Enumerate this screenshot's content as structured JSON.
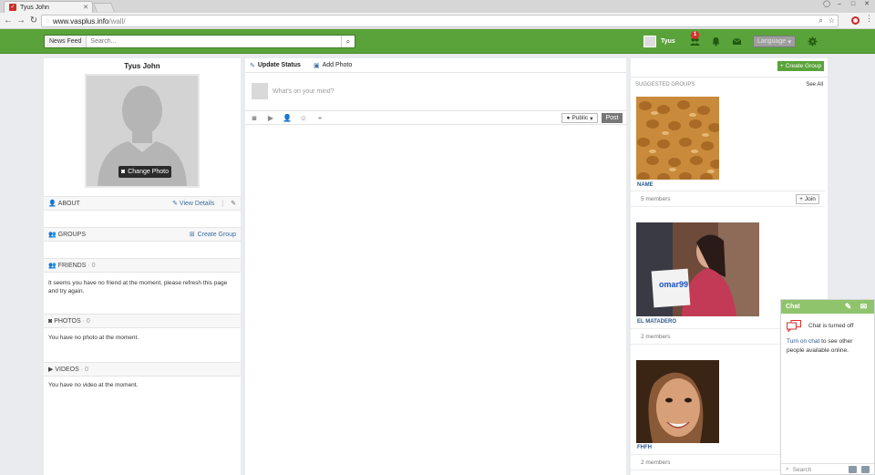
{
  "browser": {
    "tab_title": "Tyus John",
    "url_host": "www.vasplus.info",
    "url_path": "/wall/"
  },
  "topbar": {
    "news_feed_label": "News Feed",
    "search_placeholder": "Search...",
    "user_name": "Tyus",
    "notification_count": "1",
    "language_label": "Language",
    "accent_color": "#5aa33a"
  },
  "profile": {
    "name": "Tyus John",
    "change_photo_label": "Change Photo",
    "about": {
      "title": "ABOUT",
      "view_details": "View Details",
      "separator": "|"
    },
    "groups": {
      "title": "GROUPS",
      "create_group": "Create Group"
    },
    "friends": {
      "title": "FRIENDS",
      "count": "· 0",
      "empty_text": "It seems you have no friend at the moment, please refresh this page and try again."
    },
    "photos": {
      "title": "PHOTOS",
      "count": "· 0",
      "empty_text": "You have no photo at the moment."
    },
    "videos": {
      "title": "VIDEOS",
      "count": "· 0",
      "empty_text": "You have no video at the moment."
    }
  },
  "composer": {
    "update_status": "Update Status",
    "add_photo": "Add Photo",
    "placeholder": "What's on your mind?",
    "privacy_label": "Public",
    "post_label": "Post"
  },
  "suggested": {
    "create_group_label": "Create Group",
    "heading": "SUGGESTED GROUPS",
    "see_all": "See All",
    "join_label": "Join",
    "groups": [
      {
        "name": "NAME",
        "members": "5 members",
        "image_text": ""
      },
      {
        "name": "EL MATADERO",
        "members": "2 members",
        "image_text": "omar99"
      },
      {
        "name": "FHFH",
        "members": "2 members",
        "image_text": ""
      }
    ]
  },
  "chat": {
    "title": "Chat",
    "status_text": "Chat is turned off",
    "turn_on_link": "Turn on chat",
    "message_rest": " to see other people available online.",
    "search_placeholder": "Search"
  }
}
